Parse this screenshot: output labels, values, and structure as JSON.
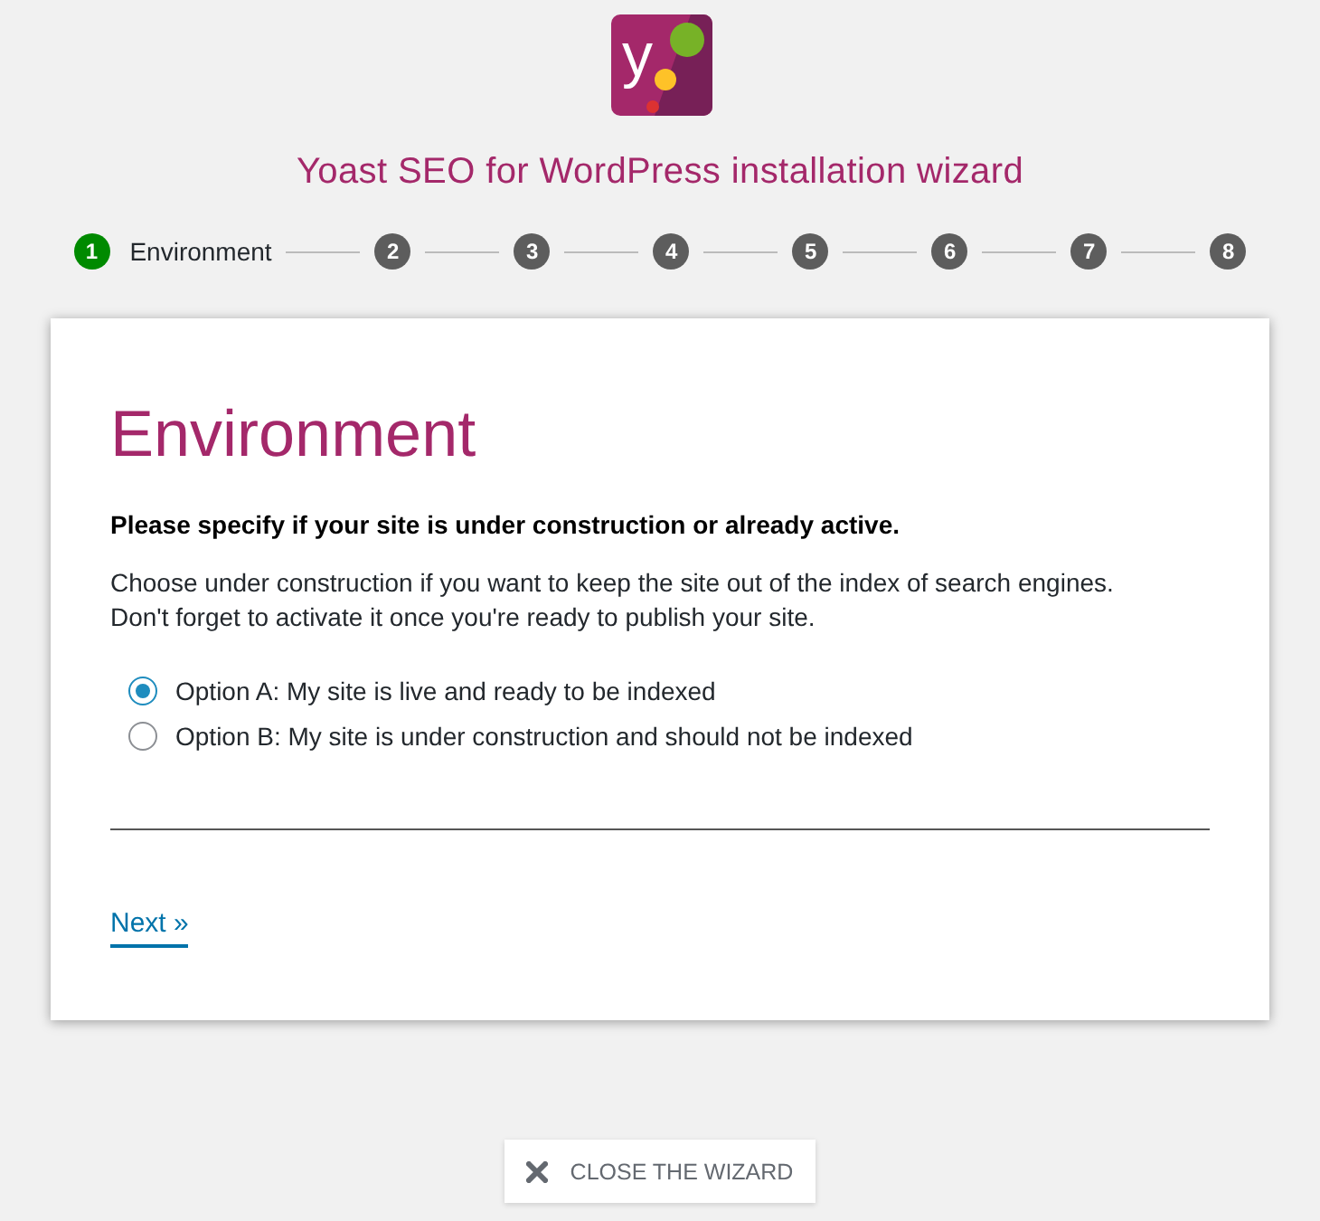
{
  "logo": {
    "letter": "y"
  },
  "title": "Yoast SEO for WordPress installation wizard",
  "steps": [
    {
      "number": "1",
      "label": "Environment",
      "selected": true
    },
    {
      "number": "2",
      "selected": false
    },
    {
      "number": "3",
      "selected": false
    },
    {
      "number": "4",
      "selected": false
    },
    {
      "number": "5",
      "selected": false
    },
    {
      "number": "6",
      "selected": false
    },
    {
      "number": "7",
      "selected": false
    },
    {
      "number": "8",
      "selected": false
    }
  ],
  "card": {
    "heading": "Environment",
    "question": "Please specify if your site is under construction or already active.",
    "description": [
      "Choose under construction if you want to keep the site out of the index of search engines.",
      "Don't forget to activate it once you're ready to publish your site."
    ],
    "options": [
      {
        "label": "Option A: My site is live and ready to be indexed",
        "selected": true
      },
      {
        "label": "Option B: My site is under construction and should not be indexed",
        "selected": false
      }
    ],
    "next_link": "Next »"
  },
  "close_button": {
    "label": "CLOSE THE WIZARD"
  }
}
